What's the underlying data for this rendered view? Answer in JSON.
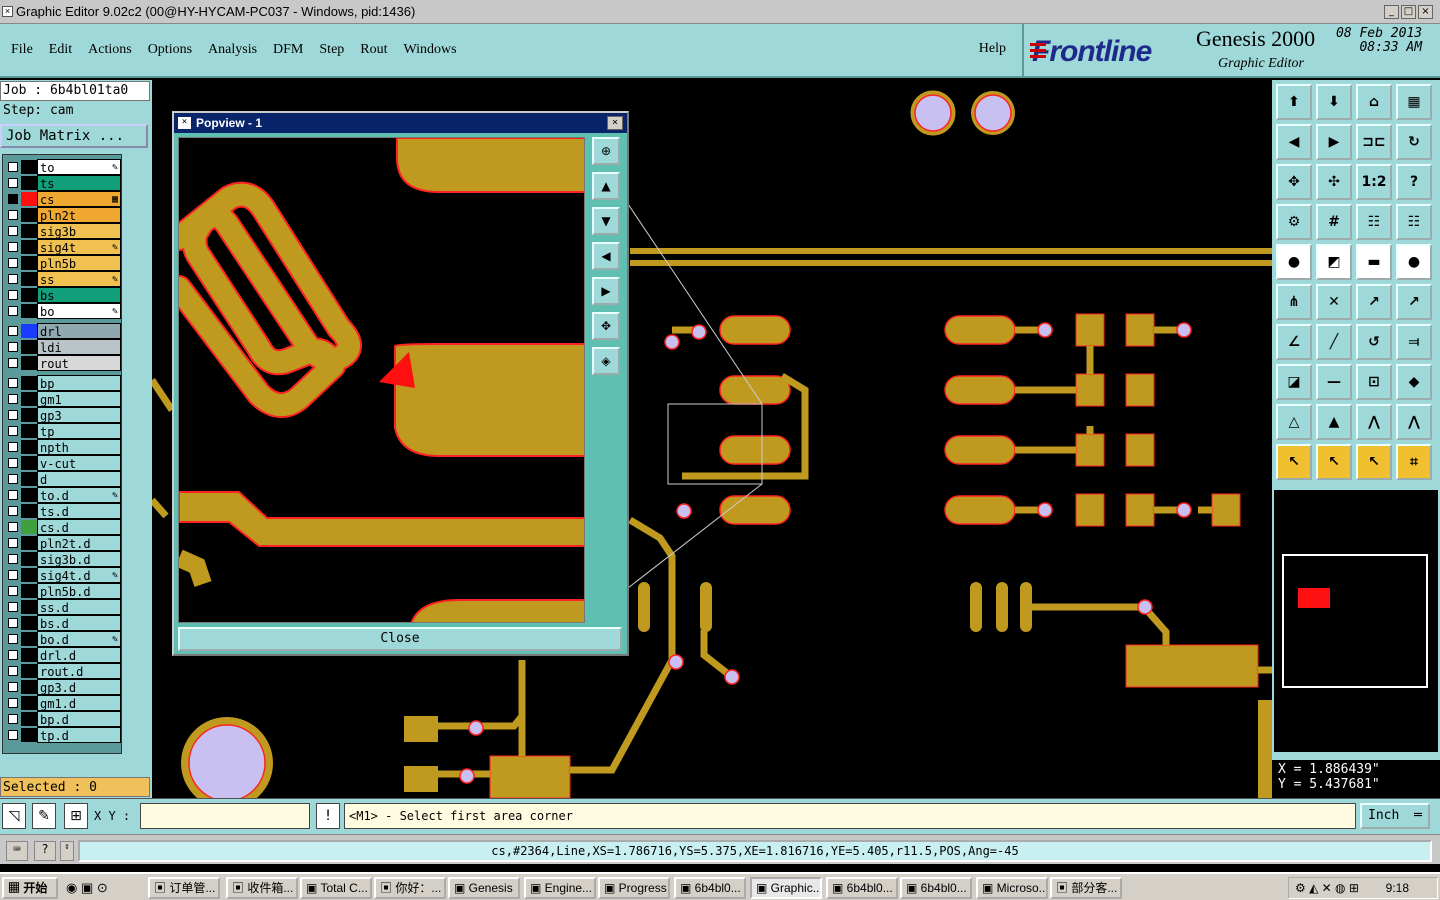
{
  "window": {
    "title": "Graphic Editor 9.02c2 (00@HY-HYCAM-PC037 - Windows, pid:1436)"
  },
  "menu": {
    "items": [
      "File",
      "Edit",
      "Actions",
      "Options",
      "Analysis",
      "DFM",
      "Step",
      "Rout",
      "Windows"
    ],
    "help": "Help"
  },
  "brand": {
    "logo": "Frontline",
    "product": "Genesis 2000",
    "subtitle": "Graphic Editor",
    "date": "08 Feb 2013",
    "time": "08:33 AM"
  },
  "job": {
    "job": "Job : 6b4bl01ta0",
    "step": "Step: cam",
    "matrix_button": "Job Matrix ..."
  },
  "layers": [
    {
      "name": "to",
      "color": "#ffffff",
      "mark": "pencil"
    },
    {
      "name": "ts",
      "color": "#12a07a",
      "mark": ""
    },
    {
      "name": "cs",
      "color": "#f0a830",
      "mark": "grid",
      "active": true
    },
    {
      "name": "pln2t",
      "color": "#f0a830",
      "mark": ""
    },
    {
      "name": "sig3b",
      "color": "#f0c050",
      "mark": ""
    },
    {
      "name": "sig4t",
      "color": "#f0c050",
      "mark": "pencil"
    },
    {
      "name": "pln5b",
      "color": "#f0c050",
      "mark": ""
    },
    {
      "name": "ss",
      "color": "#f0c050",
      "mark": "pencil"
    },
    {
      "name": "bs",
      "color": "#12a07a",
      "mark": ""
    },
    {
      "name": "bo",
      "color": "#ffffff",
      "mark": "pencil"
    },
    {
      "name": "drl",
      "color": "#90a8b0",
      "mark": ""
    },
    {
      "name": "ldi",
      "color": "#b8c4c8",
      "mark": ""
    },
    {
      "name": "rout",
      "color": "#d8d8d8",
      "mark": ""
    },
    {
      "name": "bp",
      "color": "#9fd8d8",
      "mark": ""
    },
    {
      "name": "gm1",
      "color": "#9fd8d8",
      "mark": ""
    },
    {
      "name": "gp3",
      "color": "#9fd8d8",
      "mark": ""
    },
    {
      "name": "tp",
      "color": "#9fd8d8",
      "mark": ""
    },
    {
      "name": "npth",
      "color": "#9fd8d8",
      "mark": ""
    },
    {
      "name": "v-cut",
      "color": "#9fd8d8",
      "mark": ""
    },
    {
      "name": "d",
      "color": "#9fd8d8",
      "mark": ""
    },
    {
      "name": "to.d",
      "color": "#9fd8d8",
      "mark": "pencil"
    },
    {
      "name": "ts.d",
      "color": "#9fd8d8",
      "mark": ""
    },
    {
      "name": "cs.d",
      "color": "#9fd8d8",
      "mark": ""
    },
    {
      "name": "pln2t.d",
      "color": "#9fd8d8",
      "mark": ""
    },
    {
      "name": "sig3b.d",
      "color": "#9fd8d8",
      "mark": ""
    },
    {
      "name": "sig4t.d",
      "color": "#9fd8d8",
      "mark": "pencil"
    },
    {
      "name": "pln5b.d",
      "color": "#9fd8d8",
      "mark": ""
    },
    {
      "name": "ss.d",
      "color": "#9fd8d8",
      "mark": ""
    },
    {
      "name": "bs.d",
      "color": "#9fd8d8",
      "mark": ""
    },
    {
      "name": "bo.d",
      "color": "#9fd8d8",
      "mark": "pencil"
    },
    {
      "name": "drl.d",
      "color": "#9fd8d8",
      "mark": ""
    },
    {
      "name": "rout.d",
      "color": "#9fd8d8",
      "mark": ""
    },
    {
      "name": "gp3.d",
      "color": "#9fd8d8",
      "mark": ""
    },
    {
      "name": "gm1.d",
      "color": "#9fd8d8",
      "mark": ""
    },
    {
      "name": "bp.d",
      "color": "#9fd8d8",
      "mark": ""
    },
    {
      "name": "tp.d",
      "color": "#9fd8d8",
      "mark": ""
    }
  ],
  "selected": "Selected : 0",
  "popview": {
    "title": "Popview - 1",
    "close": "Close"
  },
  "coords": {
    "x": "X = 1.886439\"",
    "y": "Y = 5.437681\""
  },
  "cmd": {
    "xy_label": "X Y :",
    "xy_value": "",
    "prompt": "<M1> - Select first area corner",
    "units": "Inch"
  },
  "info": "cs,#2364,Line,XS=1.786716,YS=5.375,XE=1.816716,YE=5.405,r11.5,POS,Ang=-45",
  "taskbar": {
    "start": "开始",
    "tasks": [
      "订单管...",
      "收件箱...",
      "Total C...",
      "你好：...",
      "Genesis",
      "Engine...",
      "Progress",
      "6b4bl0...",
      "Graphic...",
      "6b4bl0...",
      "6b4bl0...",
      "Microso...",
      "部分客..."
    ],
    "clock": "9:18"
  },
  "colors": {
    "copper": "#c09a1e",
    "teal": "#9fd8d8",
    "outline": "#ff2020",
    "pad": "#c8c0f0"
  }
}
